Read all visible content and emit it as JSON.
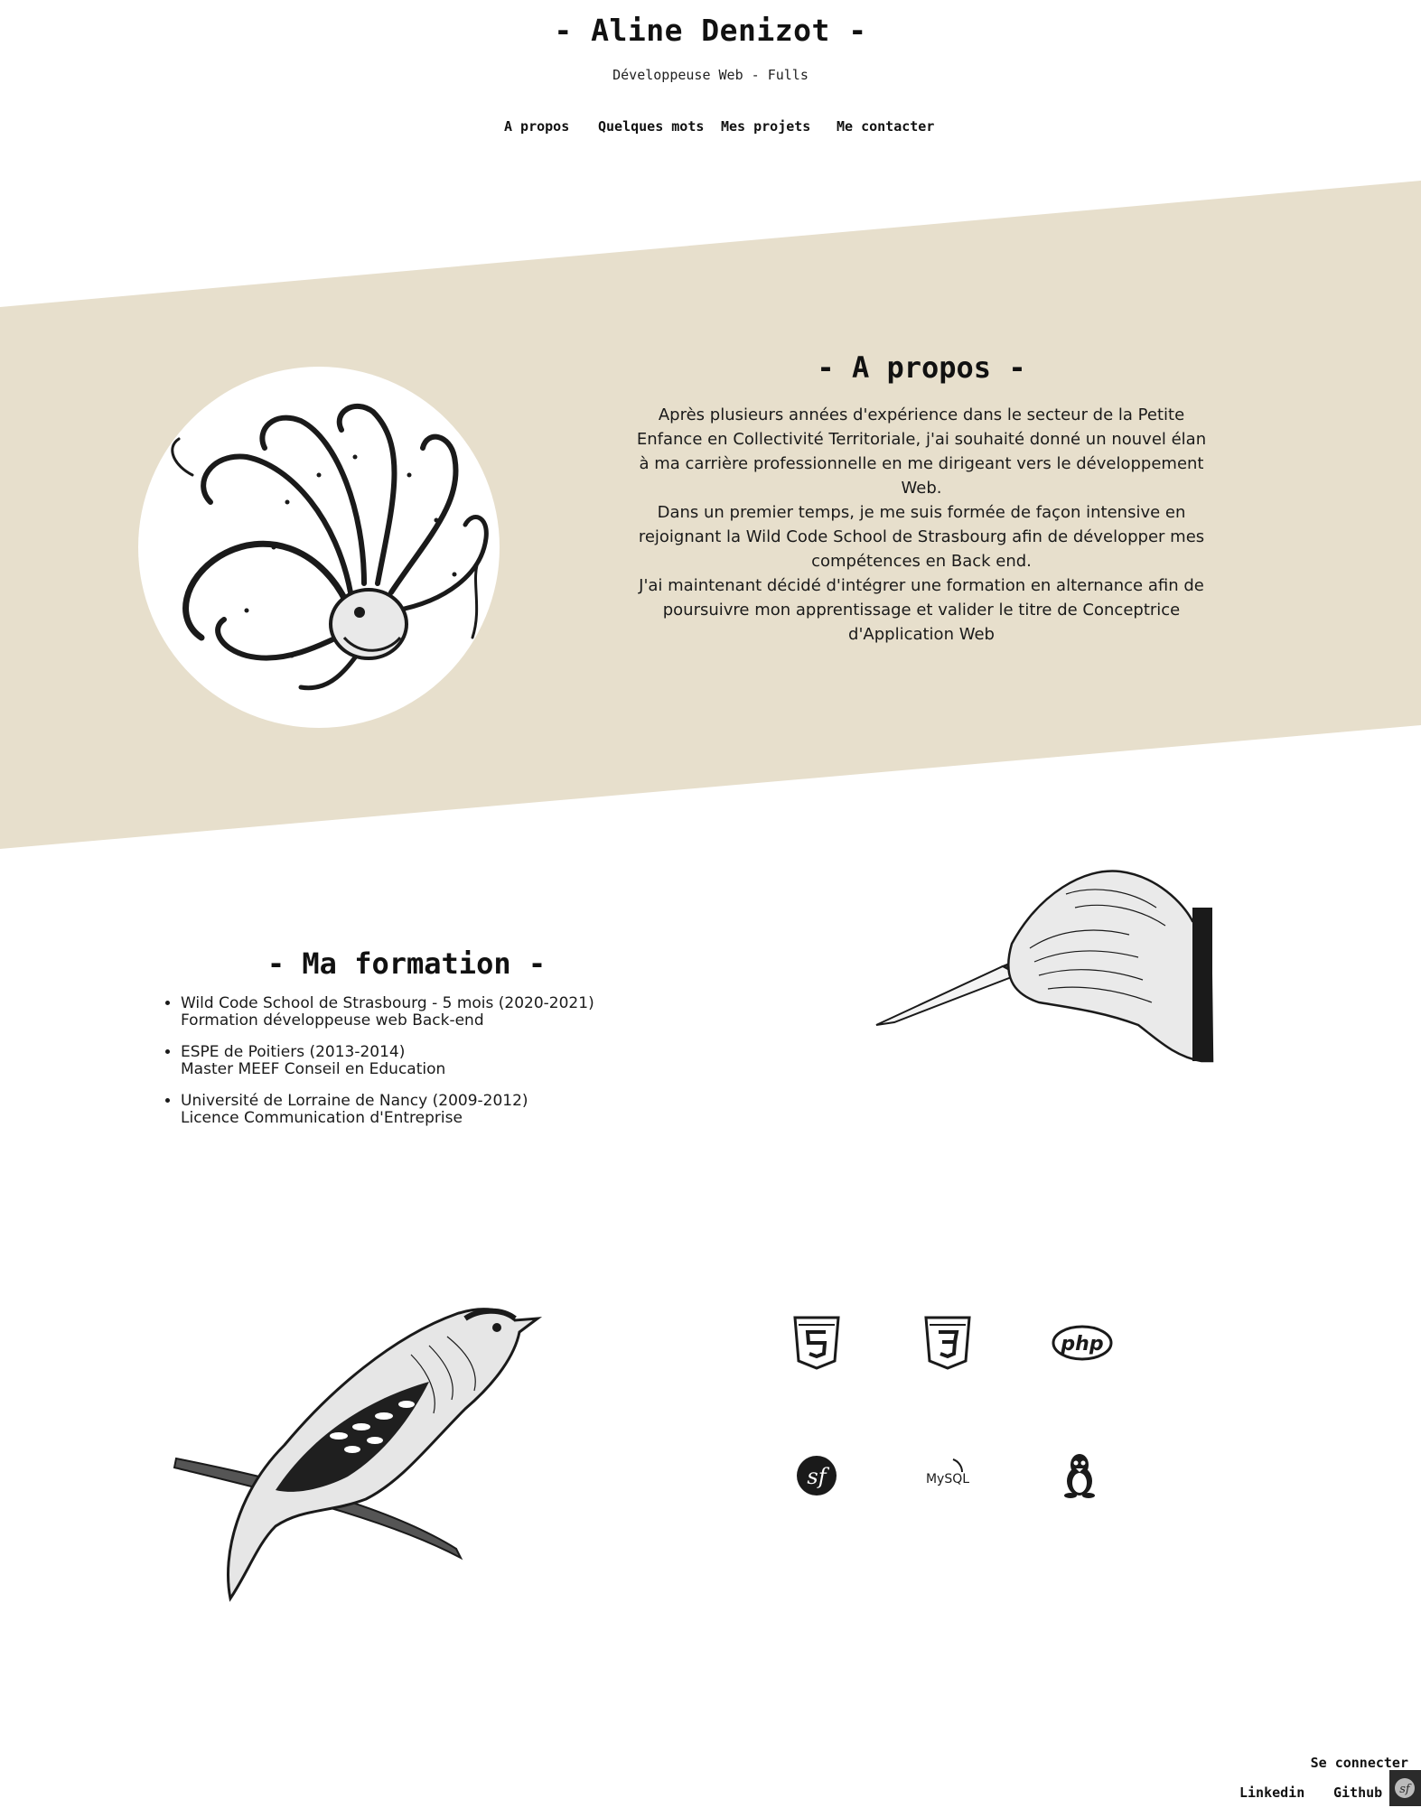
{
  "header": {
    "title": "- Aline Denizot -",
    "subtitle": "Développeuse Web - Fulls"
  },
  "nav": {
    "items": [
      {
        "label": "A propos"
      },
      {
        "label": "Quelques mots"
      },
      {
        "label": "Mes projets"
      },
      {
        "label": "Me contacter"
      }
    ]
  },
  "about": {
    "title": "- A propos -",
    "paragraphs": [
      "Après plusieurs années d'expérience dans le secteur de la Petite Enfance en Collectivité Territoriale, j'ai souhaité donné un nouvel élan à ma carrière professionnelle en me dirigeant vers le développement Web.",
      "Dans un premier temps, je me suis formée de façon intensive en rejoignant la Wild Code School de Strasbourg afin de développer mes compétences en Back end.",
      "J'ai maintenant décidé d'intégrer une formation en alternance afin de poursuivre mon apprentissage et valider le titre de Conceptrice d'Application Web"
    ],
    "image": "octopus-illustration"
  },
  "formation": {
    "title": "- Ma formation -",
    "items": [
      {
        "school": "Wild Code School de Strasbourg - 5 mois (2020-2021)",
        "detail": "Formation développeuse web Back-end"
      },
      {
        "school": "ESPE de Poitiers (2013-2014)",
        "detail": "Master MEEF Conseil en Education"
      },
      {
        "school": "Université de Lorraine de Nancy (2009-2012)",
        "detail": "Licence Communication d'Entreprise"
      }
    ],
    "image": "hand-scalpel-illustration"
  },
  "skills": {
    "image": "bird-illustration",
    "icons": [
      "html5-icon",
      "css3-icon",
      "php-icon",
      "symfony-icon",
      "mysql-icon",
      "linux-icon"
    ],
    "php_text": "php",
    "mysql_text": "MySQL"
  },
  "footer": {
    "login": "Se connecter",
    "links": [
      {
        "label": "Linkedin"
      },
      {
        "label": "Github"
      }
    ]
  },
  "colors": {
    "band": "#e7dfcc",
    "text": "#111111",
    "background": "#ffffff"
  }
}
